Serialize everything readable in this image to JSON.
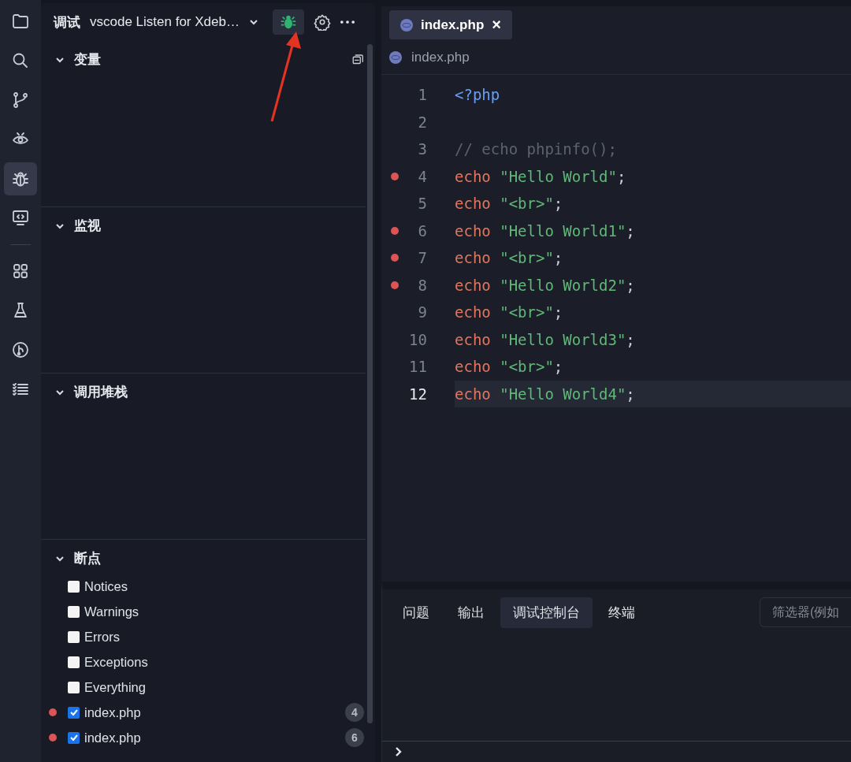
{
  "activity_bar": {
    "items": [
      {
        "selected": false
      },
      {
        "selected": false
      },
      {
        "selected": false
      },
      {
        "selected": false
      },
      {
        "selected": true
      },
      {
        "selected": false
      },
      {
        "selected": false
      },
      {
        "selected": false
      },
      {
        "selected": false
      },
      {
        "selected": false
      }
    ]
  },
  "sidebar": {
    "title": "调试",
    "configuration": "vscode Listen for Xdeb…",
    "sections": [
      {
        "title": "变量",
        "expanded": true
      },
      {
        "title": "监视",
        "expanded": true
      },
      {
        "title": "调用堆栈",
        "expanded": true
      }
    ],
    "breakpoints": {
      "title": "断点",
      "expanded": true,
      "items": [
        {
          "kind": "exception",
          "label": "Notices",
          "checked": false
        },
        {
          "kind": "exception",
          "label": "Warnings",
          "checked": false
        },
        {
          "kind": "exception",
          "label": "Errors",
          "checked": false
        },
        {
          "kind": "exception",
          "label": "Exceptions",
          "checked": false
        },
        {
          "kind": "exception",
          "label": "Everything",
          "checked": false
        },
        {
          "kind": "line",
          "label": "index.php",
          "checked": true,
          "count": "4"
        },
        {
          "kind": "line",
          "label": "index.php",
          "checked": true,
          "count": "6"
        }
      ]
    }
  },
  "editor": {
    "tabs": [
      {
        "label": "index.php",
        "selected": true,
        "close": "×"
      }
    ],
    "breadcrumb": "index.php",
    "lines": [
      {
        "number": "1",
        "breakpoint": false,
        "current": false,
        "tokens": [
          {
            "kind": "tag",
            "text": "<?php"
          }
        ]
      },
      {
        "number": "2",
        "breakpoint": false,
        "current": false
      },
      {
        "number": "3",
        "breakpoint": false,
        "current": false,
        "tokens": [
          {
            "kind": "comment",
            "text": "// echo phpinfo();"
          }
        ]
      },
      {
        "number": "4",
        "breakpoint": true,
        "current": false,
        "tokens": [
          {
            "kind": "keyword",
            "text": "echo"
          },
          {
            "kind": "string",
            "text": "\"Hello World\""
          },
          {
            "kind": "plain",
            "text": ";"
          }
        ]
      },
      {
        "number": "5",
        "breakpoint": false,
        "current": false,
        "tokens": [
          {
            "kind": "keyword",
            "text": "echo"
          },
          {
            "kind": "string",
            "text": "\"<br>\""
          },
          {
            "kind": "plain",
            "text": ";"
          }
        ]
      },
      {
        "number": "6",
        "breakpoint": true,
        "current": false,
        "tokens": [
          {
            "kind": "keyword",
            "text": "echo"
          },
          {
            "kind": "string",
            "text": "\"Hello World1\""
          },
          {
            "kind": "plain",
            "text": ";"
          }
        ]
      },
      {
        "number": "7",
        "breakpoint": true,
        "current": false,
        "tokens": [
          {
            "kind": "keyword",
            "text": "echo"
          },
          {
            "kind": "string",
            "text": "\"<br>\""
          },
          {
            "kind": "plain",
            "text": ";"
          }
        ]
      },
      {
        "number": "8",
        "breakpoint": true,
        "current": false,
        "tokens": [
          {
            "kind": "keyword",
            "text": "echo"
          },
          {
            "kind": "string",
            "text": "\"Hello World2\""
          },
          {
            "kind": "plain",
            "text": ";"
          }
        ]
      },
      {
        "number": "9",
        "breakpoint": false,
        "current": false,
        "tokens": [
          {
            "kind": "keyword",
            "text": "echo"
          },
          {
            "kind": "string",
            "text": "\"<br>\""
          },
          {
            "kind": "plain",
            "text": ";"
          }
        ]
      },
      {
        "number": "10",
        "breakpoint": false,
        "current": false,
        "tokens": [
          {
            "kind": "keyword",
            "text": "echo"
          },
          {
            "kind": "string",
            "text": "\"Hello World3\""
          },
          {
            "kind": "plain",
            "text": ";"
          }
        ]
      },
      {
        "number": "11",
        "breakpoint": false,
        "current": false,
        "tokens": [
          {
            "kind": "keyword",
            "text": "echo"
          },
          {
            "kind": "string",
            "text": "\"<br>\""
          },
          {
            "kind": "plain",
            "text": ";"
          }
        ]
      },
      {
        "number": "12",
        "breakpoint": false,
        "current": true,
        "tokens": [
          {
            "kind": "keyword",
            "text": "echo"
          },
          {
            "kind": "string",
            "text": "\"Hello World4\""
          },
          {
            "kind": "plain",
            "text": ";"
          }
        ]
      }
    ]
  },
  "panel": {
    "tabs": [
      {
        "label": "问题",
        "selected": false
      },
      {
        "label": "输出",
        "selected": false
      },
      {
        "label": "调试控制台",
        "selected": true
      },
      {
        "label": "终端",
        "selected": false
      }
    ],
    "filter": {
      "placeholder": "筛选器(例如"
    }
  }
}
